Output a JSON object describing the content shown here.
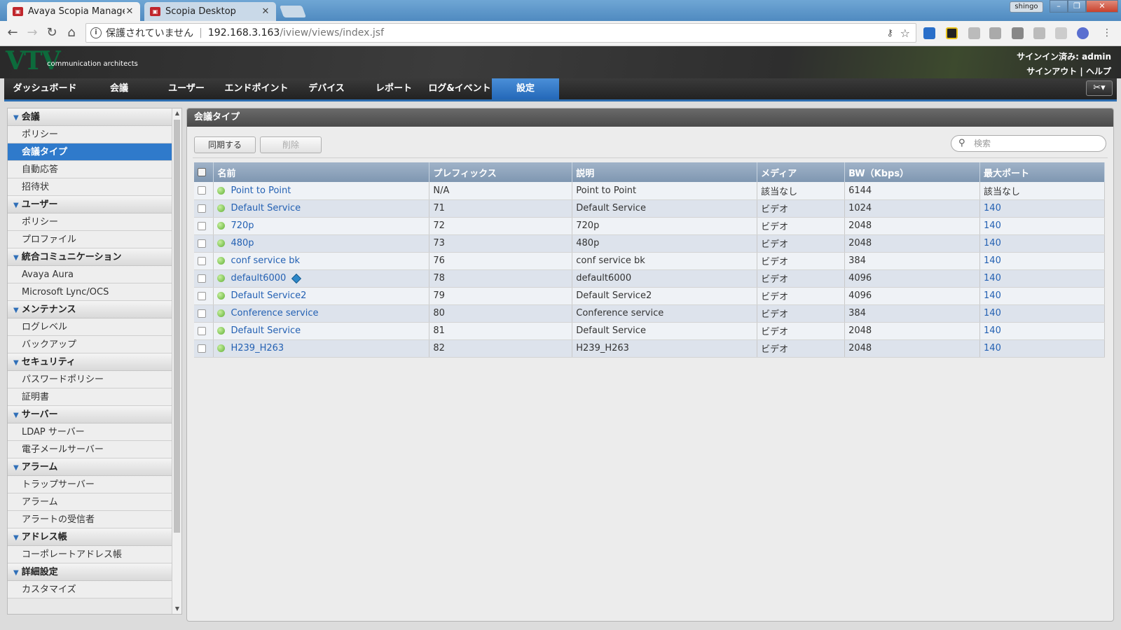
{
  "browser": {
    "tabs": [
      {
        "label": "Avaya Scopia Manager",
        "active": true
      },
      {
        "label": "Scopia Desktop",
        "active": false
      }
    ],
    "user_badge": "shingo",
    "address": {
      "security_label": "保護されていません",
      "host": "192.168.3.163",
      "path": "/iview/views/index.jsf"
    }
  },
  "app": {
    "logo": "VTV",
    "logo_tagline": "communication architects",
    "signin": "サインイン済み: admin",
    "links": "サインアウト | ヘルプ"
  },
  "nav": {
    "items": [
      "ダッシュボード",
      "会議",
      "ユーザー",
      "エンドポイント",
      "デバイス",
      "レポート",
      "ログ&イベント",
      "設定"
    ],
    "active": "設定"
  },
  "sidebar": {
    "sections": [
      {
        "title": "会議",
        "items": [
          "ポリシー",
          "会議タイプ",
          "自動応答",
          "招待状"
        ]
      },
      {
        "title": "ユーザー",
        "items": [
          "ポリシー",
          "プロファイル"
        ]
      },
      {
        "title": "統合コミュニケーション",
        "items": [
          "Avaya Aura",
          "Microsoft Lync/OCS"
        ]
      },
      {
        "title": "メンテナンス",
        "items": [
          "ログレベル",
          "バックアップ"
        ]
      },
      {
        "title": "セキュリティ",
        "items": [
          "パスワードポリシー",
          "証明書"
        ]
      },
      {
        "title": "サーバー",
        "items": [
          "LDAP サーバー",
          "電子メールサーバー"
        ]
      },
      {
        "title": "アラーム",
        "items": [
          "トラップサーバー",
          "アラーム",
          "アラートの受信者"
        ]
      },
      {
        "title": "アドレス帳",
        "items": [
          "コーポレートアドレス帳"
        ]
      },
      {
        "title": "詳細設定",
        "items": [
          "カスタマイズ"
        ]
      }
    ],
    "active_item": "会議タイプ"
  },
  "panel": {
    "title": "会議タイプ",
    "sync_button": "同期する",
    "delete_button": "削除",
    "search_placeholder": "検索",
    "columns": [
      "名前",
      "プレフィックス",
      "説明",
      "メディア",
      "BW（Kbps）",
      "最大ポート"
    ],
    "rows": [
      {
        "name": "Point to Point",
        "prefix": "N/A",
        "desc": "Point to Point",
        "media": "該当なし",
        "bw": "6144",
        "ports": "該当なし",
        "ports_link": false,
        "badge": false
      },
      {
        "name": "Default Service",
        "prefix": "71",
        "desc": "Default Service",
        "media": "ビデオ",
        "bw": "1024",
        "ports": "140",
        "ports_link": true,
        "badge": false
      },
      {
        "name": "720p",
        "prefix": "72",
        "desc": "720p",
        "media": "ビデオ",
        "bw": "2048",
        "ports": "140",
        "ports_link": true,
        "badge": false
      },
      {
        "name": "480p",
        "prefix": "73",
        "desc": "480p",
        "media": "ビデオ",
        "bw": "2048",
        "ports": "140",
        "ports_link": true,
        "badge": false
      },
      {
        "name": "conf service bk",
        "prefix": "76",
        "desc": "conf service bk",
        "media": "ビデオ",
        "bw": "384",
        "ports": "140",
        "ports_link": true,
        "badge": false
      },
      {
        "name": "default6000",
        "prefix": "78",
        "desc": "default6000",
        "media": "ビデオ",
        "bw": "4096",
        "ports": "140",
        "ports_link": true,
        "badge": true
      },
      {
        "name": "Default Service2",
        "prefix": "79",
        "desc": "Default Service2",
        "media": "ビデオ",
        "bw": "4096",
        "ports": "140",
        "ports_link": true,
        "badge": false
      },
      {
        "name": "Conference service",
        "prefix": "80",
        "desc": "Conference service",
        "media": "ビデオ",
        "bw": "384",
        "ports": "140",
        "ports_link": true,
        "badge": false
      },
      {
        "name": "Default Service",
        "prefix": "81",
        "desc": "Default Service",
        "media": "ビデオ",
        "bw": "2048",
        "ports": "140",
        "ports_link": true,
        "badge": false
      },
      {
        "name": "H239_H263",
        "prefix": "82",
        "desc": "H239_H263",
        "media": "ビデオ",
        "bw": "2048",
        "ports": "140",
        "ports_link": true,
        "badge": false
      }
    ]
  },
  "colors": {
    "accent": "#2f7acb",
    "link": "#2461b3",
    "status_ok": "#5fb034"
  }
}
